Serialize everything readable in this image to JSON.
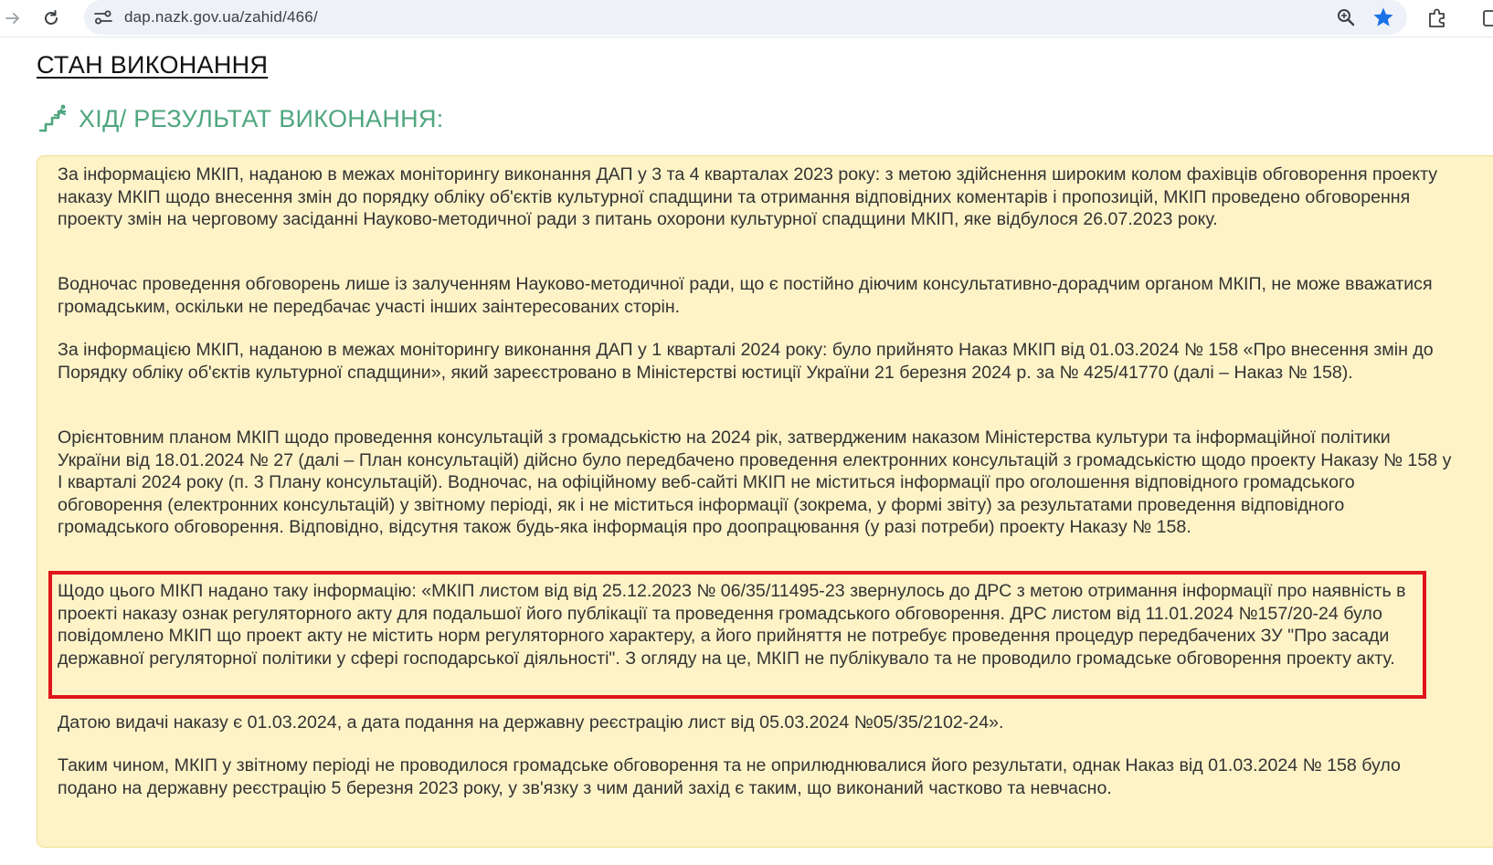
{
  "browser": {
    "url": "dap.nazk.gov.ua/zahid/466/",
    "icons": [
      "forward-arrow-icon",
      "reload-icon",
      "site-settings-icon",
      "zoom-icon",
      "bookmark-star-icon",
      "extensions-icon"
    ],
    "accent": "#1a73e8"
  },
  "page": {
    "section_title": "СТАН ВИКОНАННЯ",
    "subtitle": "ХІД/ РЕЗУЛЬТАТ ВИКОНАННЯ:",
    "subtitle_color": "#4fa67f",
    "box_background": "#fdf3c7",
    "highlight_color": "#e0141b",
    "paragraphs": [
      "За інформацією МКІП, наданою в межах моніторингу виконання ДАП у 3 та 4 кварталах 2023 року: з метою здійснення широким колом фахівців обговорення проекту наказу МКІП щодо внесення змін до порядку обліку об'єктів культурної спадщини та отримання відповідних коментарів і пропозицій, МКІП проведено обговорення проекту змін на черговому засіданні Науково-методичної ради з питань охорони культурної спадщини МКІП, яке відбулося 26.07.2023 року.",
      "Водночас проведення обговорень лише із залученням Науково-методичної ради, що є постійно діючим консультативно-дорадчим органом МКІП, не може вважатися громадським, оскільки не передбачає участі інших заінтересованих сторін.",
      "За інформацією МКІП, наданою в межах моніторингу виконання ДАП у 1 кварталі 2024 року: було прийнято Наказ МКІП від 01.03.2024 № 158 «Про внесення змін до Порядку обліку об'єктів культурної спадщини», який зареєстровано в Міністерстві юстиції України 21 березня 2024 р. за № 425/41770 (далі – Наказ № 158).",
      "Орієнтовним планом МКІП щодо проведення консультацій з громадськістю на 2024 рік, затвердженим наказом Міністерства культури та інформаційної політики України від 18.01.2024 № 27 (далі – План консультацій) дійсно було передбачено проведення електронних консультацій з громадськістю щодо проекту Наказу № 158 у І кварталі 2024 року (п. 3 Плану консультацій). Водночас, на офіційному веб-сайті МКІП не міститься інформації про оголошення відповідного громадського обговорення (електронних консультацій) у звітному періоді, як і не міститься інформації (зокрема, у формі звіту) за результатами проведення відповідного громадського обговорення. Відповідно, відсутня також будь-яка інформація про доопрацювання (у разі потреби) проекту Наказу № 158.",
      "Щодо цього МІКП надано таку інформацію: «МКІП листом від від 25.12.2023 № 06/35/11495-23 звернулось до ДРС з метою отримання інформації про наявність в проекті наказу ознак регуляторного акту для подальшої його публікації та проведення громадського обговорення. ДРС листом від 11.01.2024 №157/20-24 було повідомлено МКІП що проект акту не містить норм регуляторного характеру, а його прийняття не потребує проведення процедур передбачених ЗУ \"Про засади державної регуляторної політики у сфері господарської діяльності\". З огляду на це, МКІП не публікувало та не проводило громадське обговорення проекту акту.",
      "Датою видачі наказу є 01.03.2024, а дата подання на державну реєстрацію лист від 05.03.2024 №05/35/2102-24».",
      "Таким чином, МКІП у звітному періоді не проводилося громадське обговорення та не оприлюднювалися його результати, однак Наказ від 01.03.2024 № 158 було подано на державну реєстрацію 5 березня 2023 року, у зв'язку з чим даний захід є таким, що виконаний частково та невчасно."
    ]
  }
}
